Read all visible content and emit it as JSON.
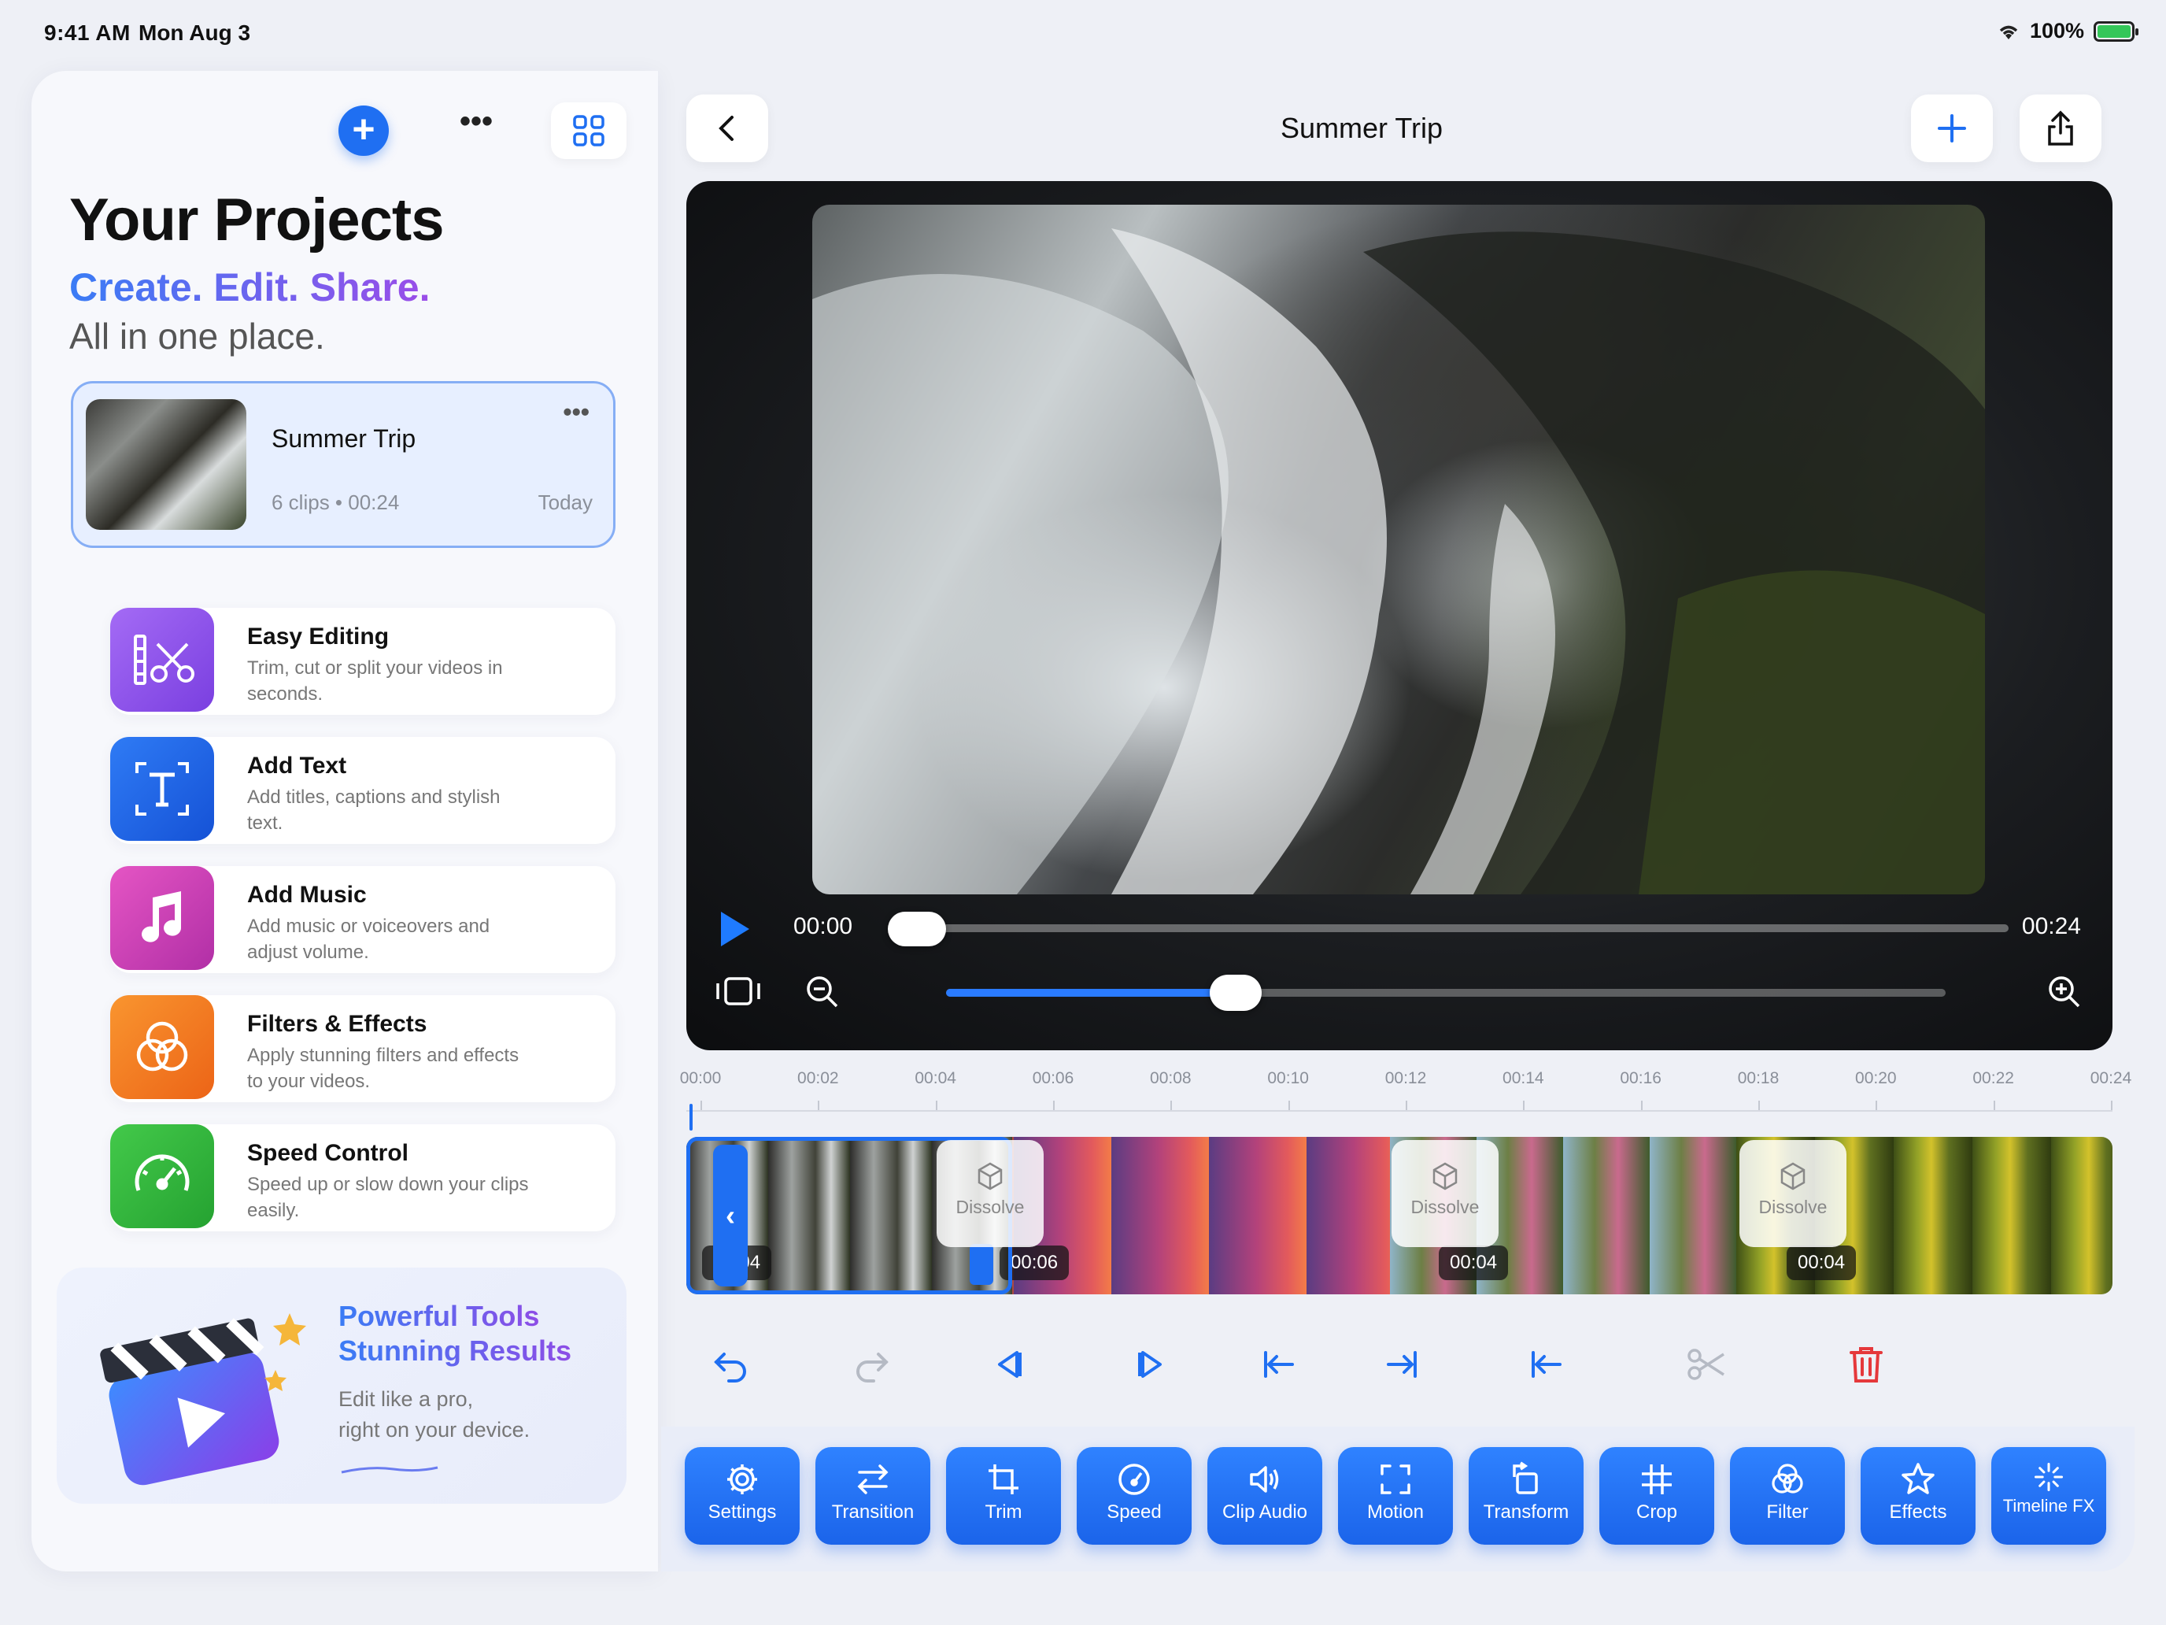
{
  "status": {
    "time": "9:41 AM",
    "date": "Mon Aug 3",
    "battery": "100%"
  },
  "sidebar": {
    "title": "Your Projects",
    "tagline": "Create. Edit. Share.",
    "subtitle": "All in one place.",
    "project": {
      "name": "Summer Trip",
      "meta": "6 clips • 00:24",
      "date": "Today",
      "more": "•••"
    },
    "features": [
      {
        "title": "Easy Editing",
        "desc": "Trim, cut or split your videos in seconds.",
        "icon": "scissors-icon",
        "color": "#8e5cf0"
      },
      {
        "title": "Add Text",
        "desc": "Add titles, captions and stylish text.",
        "icon": "text-icon",
        "color": "#1e63e6"
      },
      {
        "title": "Add Music",
        "desc": "Add music or voiceovers and adjust volume.",
        "icon": "music-note-icon",
        "color": "#d63fb5"
      },
      {
        "title": "Filters & Effects",
        "desc": "Apply stunning filters and effects to your videos.",
        "icon": "filters-icon",
        "color": "#f47a1f"
      },
      {
        "title": "Speed Control",
        "desc": "Speed up or slow down your clips easily.",
        "icon": "speedometer-icon",
        "color": "#2fb83c"
      }
    ],
    "promo": {
      "title_line1": "Powerful Tools",
      "title_line2": "Stunning Results",
      "desc_line1": "Edit like a pro,",
      "desc_line2": "right on your device."
    }
  },
  "editor": {
    "title": "Summer Trip",
    "player": {
      "time_start": "00:00",
      "time_end": "00:24",
      "playback_progress": 0.0,
      "zoom_level": 0.29
    },
    "ruler": [
      "00:00",
      "00:02",
      "00:04",
      "00:06",
      "00:08",
      "00:10",
      "00:12",
      "00:14",
      "00:16",
      "00:18",
      "00:20",
      "00:22",
      "00:24"
    ],
    "clips": [
      {
        "badge": "00:04"
      },
      {
        "badge": "00:06"
      },
      {
        "badge": "00:04"
      },
      {
        "badge": "00:04"
      }
    ],
    "transitions": [
      {
        "label": "Dissolve"
      },
      {
        "label": "Dissolve"
      },
      {
        "label": "Dissolve"
      }
    ],
    "toolbar": [
      {
        "label": "Settings",
        "icon": "gear-icon"
      },
      {
        "label": "Transition",
        "icon": "transition-icon"
      },
      {
        "label": "Trim",
        "icon": "trim-icon"
      },
      {
        "label": "Speed",
        "icon": "speed-icon"
      },
      {
        "label": "Clip Audio",
        "icon": "speaker-icon"
      },
      {
        "label": "Motion",
        "icon": "motion-icon"
      },
      {
        "label": "Transform",
        "icon": "transform-icon"
      },
      {
        "label": "Crop",
        "icon": "crop-icon"
      },
      {
        "label": "Filter",
        "icon": "filter-icon"
      },
      {
        "label": "Effects",
        "icon": "star-icon"
      },
      {
        "label": "Timeline FX",
        "icon": "sparkle-icon"
      }
    ]
  },
  "colors": {
    "accent": "#1f6ff2",
    "delete": "#e5383b"
  }
}
